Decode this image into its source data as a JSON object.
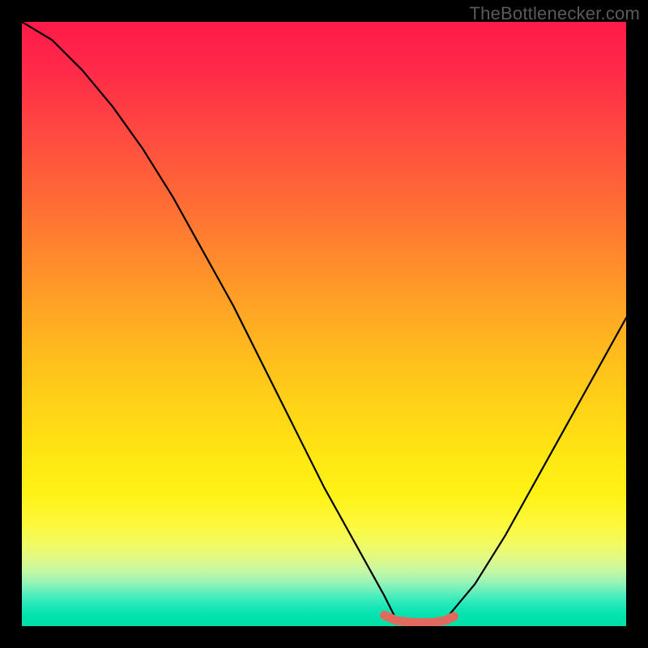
{
  "watermark": "TheBottlenecker.com",
  "chart_data": {
    "type": "line",
    "title": "",
    "xlabel": "",
    "ylabel": "",
    "xlim": [
      0,
      100
    ],
    "ylim": [
      0,
      100
    ],
    "note": "Axes are unlabeled in the source image; x and y are normalized 0–100. y=0 (green) is optimal, y=100 (red) is worst. The black curve is a V-shape reaching ~0 near x≈62–70; the short red segment marks the bottom of the valley.",
    "series": [
      {
        "name": "bottleneck-curve",
        "color": "#000000",
        "x": [
          0,
          5,
          10,
          15,
          20,
          25,
          30,
          35,
          40,
          45,
          50,
          55,
          60,
          62,
          65,
          68,
          70,
          75,
          80,
          85,
          90,
          95,
          100
        ],
        "y": [
          100,
          97,
          92,
          86,
          79,
          71,
          62,
          53,
          43,
          33,
          23,
          14,
          5,
          1,
          0,
          0,
          1,
          7,
          15,
          24,
          33,
          42,
          51
        ]
      },
      {
        "name": "optimal-range-marker",
        "color": "#e06a5e",
        "x": [
          60,
          62,
          65,
          68,
          70,
          71.5
        ],
        "y": [
          1.8,
          0.9,
          0.6,
          0.6,
          0.9,
          1.6
        ]
      }
    ]
  }
}
